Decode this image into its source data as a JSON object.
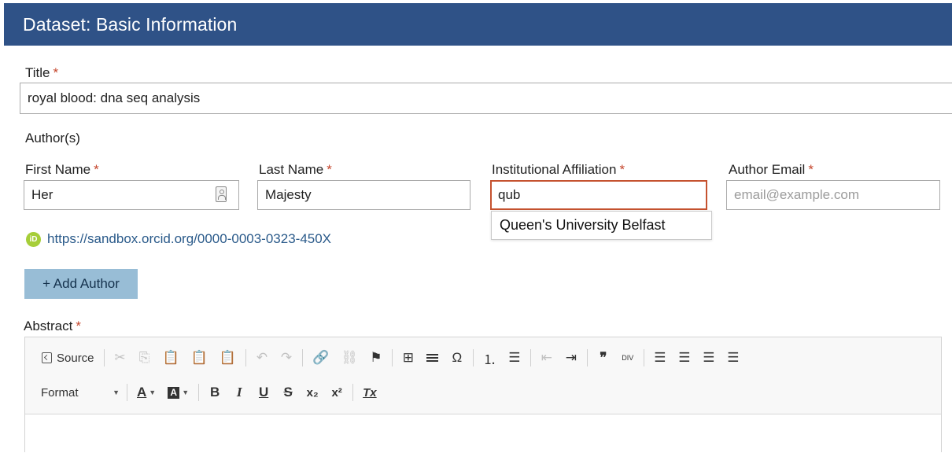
{
  "header": {
    "title": "Dataset: Basic Information"
  },
  "title_field": {
    "label": "Title",
    "required_mark": "*",
    "value": "royal blood: dna seq analysis"
  },
  "authors": {
    "section_label": "Author(s)",
    "first_name": {
      "label": "First Name",
      "required_mark": "*",
      "value": "Her"
    },
    "last_name": {
      "label": "Last Name",
      "required_mark": "*",
      "value": "Majesty"
    },
    "affiliation": {
      "label": "Institutional Affiliation",
      "required_mark": "*",
      "value": "qub",
      "suggestion": "Queen's University Belfast"
    },
    "email": {
      "label": "Author Email",
      "required_mark": "*",
      "placeholder": "email@example.com"
    },
    "orcid": {
      "icon": "orcid-icon",
      "icon_text": "iD",
      "link": "https://sandbox.orcid.org/0000-0003-0323-450X"
    },
    "add_author_button": "+ Add Author"
  },
  "abstract": {
    "label": "Abstract",
    "required_mark": "*",
    "toolbar": {
      "source": "Source",
      "format": "Format",
      "glyphs": {
        "cut": "✂",
        "copy": "⎘",
        "paste": "📋",
        "paste_text": "📋",
        "paste_word": "📋",
        "undo": "↶",
        "redo": "↷",
        "link": "🔗",
        "unlink": "⛓",
        "anchor": "⚑",
        "table": "⊞",
        "omega": "Ω",
        "numbered_list": "⒈",
        "bulleted_list": "☰",
        "outdent": "⇤",
        "indent": "⇥",
        "blockquote": "❞",
        "div": "DIV",
        "align_left": "☰",
        "align_center": "☰",
        "align_right": "☰",
        "justify": "☰",
        "text_color": "A",
        "bg_color": "A",
        "bold": "B",
        "italic": "I",
        "underline": "U",
        "strike": "S",
        "subscript": "x₂",
        "superscript": "x²",
        "remove_format": "Tx"
      }
    }
  },
  "colors": {
    "header_bg": "#2f5287",
    "required": "#c5452c",
    "focus_border": "#c5522f",
    "add_button_bg": "#98bdd6",
    "link": "#2a5a8a",
    "orcid_green": "#a6ce39"
  }
}
